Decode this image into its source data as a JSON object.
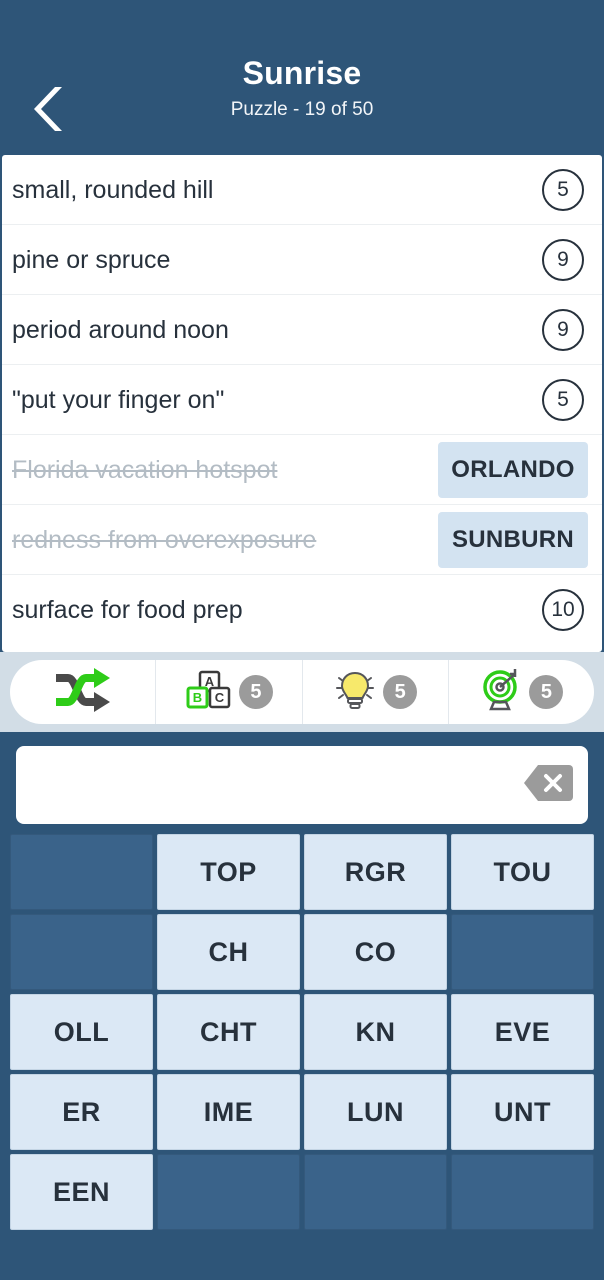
{
  "header": {
    "back_icon": "chevron-left-icon",
    "title": "Sunrise",
    "subtitle": "Puzzle - 19 of 50"
  },
  "clues": [
    {
      "text": "small, rounded hill",
      "length": "5",
      "solved": false,
      "answer": ""
    },
    {
      "text": "pine or spruce",
      "length": "9",
      "solved": false,
      "answer": ""
    },
    {
      "text": "period around noon",
      "length": "9",
      "solved": false,
      "answer": ""
    },
    {
      "text": "\"put your finger on\"",
      "length": "5",
      "solved": false,
      "answer": ""
    },
    {
      "text": "Florida vacation hotspot",
      "length": "7",
      "solved": true,
      "answer": "ORLANDO"
    },
    {
      "text": "redness from overexposure",
      "length": "7",
      "solved": true,
      "answer": "SUNBURN"
    },
    {
      "text": "surface for food prep",
      "length": "10",
      "solved": false,
      "answer": ""
    }
  ],
  "powerups": [
    {
      "name": "shuffle-powerup",
      "icon": "shuffle-icon",
      "count": ""
    },
    {
      "name": "reveal-letter-powerup",
      "icon": "letter-blocks-icon",
      "count": "5"
    },
    {
      "name": "hint-powerup",
      "icon": "lightbulb-icon",
      "count": "5"
    },
    {
      "name": "target-powerup",
      "icon": "target-icon",
      "count": "5"
    }
  ],
  "input": {
    "value": "",
    "placeholder": "",
    "backspace_icon": "backspace-icon"
  },
  "tiles": [
    {
      "label": "",
      "filled": false
    },
    {
      "label": "TOP",
      "filled": true
    },
    {
      "label": "RGR",
      "filled": true
    },
    {
      "label": "TOU",
      "filled": true
    },
    {
      "label": "",
      "filled": false
    },
    {
      "label": "CH",
      "filled": true
    },
    {
      "label": "CO",
      "filled": true
    },
    {
      "label": "",
      "filled": false
    },
    {
      "label": "OLL",
      "filled": true
    },
    {
      "label": "CHT",
      "filled": true
    },
    {
      "label": "KN",
      "filled": true
    },
    {
      "label": "EVE",
      "filled": true
    },
    {
      "label": "ER",
      "filled": true
    },
    {
      "label": "IME",
      "filled": true
    },
    {
      "label": "LUN",
      "filled": true
    },
    {
      "label": "UNT",
      "filled": true
    },
    {
      "label": "EEN",
      "filled": true
    },
    {
      "label": "",
      "filled": false
    },
    {
      "label": "",
      "filled": false
    },
    {
      "label": "",
      "filled": false
    }
  ],
  "colors": {
    "background": "#2e5578",
    "tile_filled": "#dbe8f5",
    "tile_empty": "#3a638a",
    "answer_chip": "#d3e3f1",
    "accent_green": "#2ecc18",
    "badge_gray": "#9b9b9b",
    "bulb_yellow": "#f7e96b"
  }
}
